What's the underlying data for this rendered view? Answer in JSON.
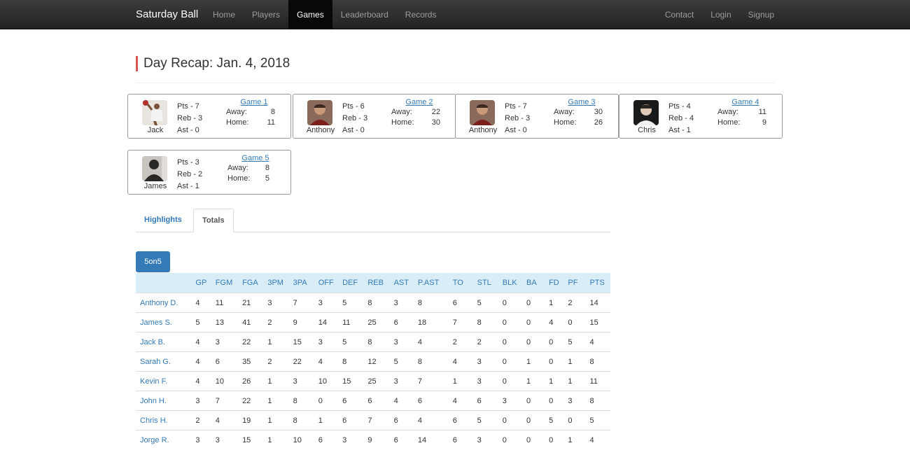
{
  "nav": {
    "brand": "Saturday Ball",
    "left": [
      "Home",
      "Players",
      "Games",
      "Leaderboard",
      "Records"
    ],
    "active": "Games",
    "right": [
      "Contact",
      "Login",
      "Signup"
    ]
  },
  "page": {
    "title": "Day Recap: Jan. 4, 2018"
  },
  "games": [
    {
      "player": "Jack",
      "pts": "Pts - 7",
      "reb": "Reb - 3",
      "ast": "Ast - 0",
      "link": "Game 1",
      "away_label": "Away:",
      "away": "8",
      "home_label": "Home:",
      "home": "11"
    },
    {
      "player": "Anthony",
      "pts": "Pts - 6",
      "reb": "Reb - 3",
      "ast": "Ast - 0",
      "link": "Game 2",
      "away_label": "Away:",
      "away": "22",
      "home_label": "Home:",
      "home": "30"
    },
    {
      "player": "Anthony",
      "pts": "Pts - 7",
      "reb": "Reb - 3",
      "ast": "Ast - 0",
      "link": "Game 3",
      "away_label": "Away:",
      "away": "30",
      "home_label": "Home:",
      "home": "26"
    },
    {
      "player": "Chris",
      "pts": "Pts - 4",
      "reb": "Reb - 4",
      "ast": "Ast - 1",
      "link": "Game 4",
      "away_label": "Away:",
      "away": "11",
      "home_label": "Home:",
      "home": "9"
    },
    {
      "player": "James",
      "pts": "Pts - 3",
      "reb": "Reb - 2",
      "ast": "Ast - 1",
      "link": "Game 5",
      "away_label": "Away:",
      "away": "8",
      "home_label": "Home:",
      "home": "5"
    }
  ],
  "tabs": [
    "Highlights",
    "Totals"
  ],
  "active_tab": "Totals",
  "pill": "5on5",
  "table": {
    "headers": [
      "",
      "GP",
      "FGM",
      "FGA",
      "3PM",
      "3PA",
      "OFF",
      "DEF",
      "REB",
      "AST",
      "P.AST",
      "TO",
      "STL",
      "BLK",
      "BA",
      "FD",
      "PF",
      "PTS"
    ],
    "rows": [
      [
        "Anthony D.",
        "4",
        "11",
        "21",
        "3",
        "7",
        "3",
        "5",
        "8",
        "3",
        "8",
        "6",
        "5",
        "0",
        "0",
        "1",
        "2",
        "14"
      ],
      [
        "James S.",
        "5",
        "13",
        "41",
        "2",
        "9",
        "14",
        "11",
        "25",
        "6",
        "18",
        "7",
        "8",
        "0",
        "0",
        "4",
        "0",
        "15"
      ],
      [
        "Jack B.",
        "4",
        "3",
        "22",
        "1",
        "15",
        "3",
        "5",
        "8",
        "3",
        "4",
        "2",
        "2",
        "0",
        "0",
        "0",
        "5",
        "4"
      ],
      [
        "Sarah G.",
        "4",
        "6",
        "35",
        "2",
        "22",
        "4",
        "8",
        "12",
        "5",
        "8",
        "4",
        "3",
        "0",
        "1",
        "0",
        "1",
        "8"
      ],
      [
        "Kevin F.",
        "4",
        "10",
        "26",
        "1",
        "3",
        "10",
        "15",
        "25",
        "3",
        "7",
        "1",
        "3",
        "0",
        "1",
        "1",
        "1",
        "11"
      ],
      [
        "John H.",
        "3",
        "7",
        "22",
        "1",
        "8",
        "0",
        "6",
        "6",
        "4",
        "6",
        "4",
        "6",
        "3",
        "0",
        "0",
        "3",
        "8"
      ],
      [
        "Chris H.",
        "2",
        "4",
        "19",
        "1",
        "8",
        "1",
        "6",
        "7",
        "6",
        "4",
        "6",
        "5",
        "0",
        "0",
        "5",
        "0",
        "5"
      ],
      [
        "Jorge R.",
        "3",
        "3",
        "15",
        "1",
        "10",
        "6",
        "3",
        "9",
        "6",
        "14",
        "6",
        "3",
        "0",
        "0",
        "0",
        "1",
        "4"
      ]
    ]
  }
}
